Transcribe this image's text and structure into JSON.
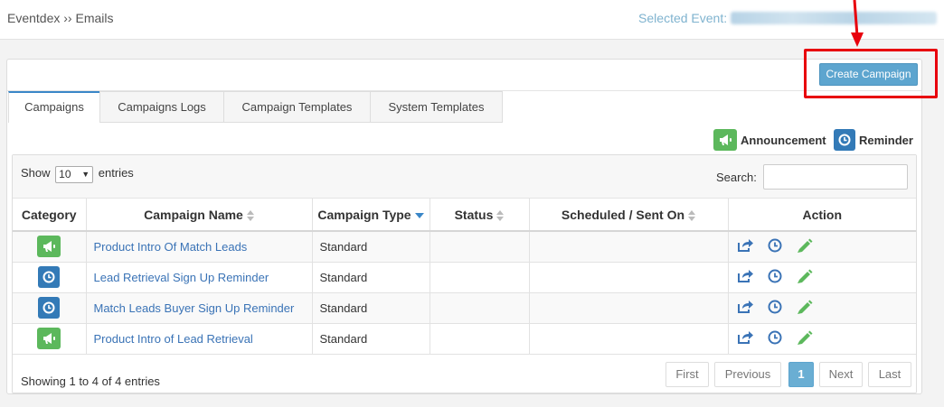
{
  "breadcrumb": "Eventdex ›› Emails",
  "selected_event_label": "Selected Event:",
  "create_button": "Create Campaign",
  "tabs": [
    {
      "label": "Campaigns",
      "active": true
    },
    {
      "label": "Campaigns Logs",
      "active": false
    },
    {
      "label": "Campaign Templates",
      "active": false
    },
    {
      "label": "System Templates",
      "active": false
    }
  ],
  "legend": {
    "announcement": "Announcement",
    "reminder": "Reminder"
  },
  "controls": {
    "show": "Show",
    "page_size": "10",
    "entries": "entries",
    "search": "Search:"
  },
  "table": {
    "headers": [
      "Category",
      "Campaign Name",
      "Campaign Type",
      "Status",
      "Scheduled / Sent On",
      "Action"
    ],
    "rows": [
      {
        "category": "announcement",
        "name": "Product Intro Of Match Leads",
        "type": "Standard",
        "status": "",
        "scheduled": ""
      },
      {
        "category": "reminder",
        "name": "Lead Retrieval Sign Up Reminder",
        "type": "Standard",
        "status": "",
        "scheduled": ""
      },
      {
        "category": "reminder",
        "name": "Match Leads Buyer Sign Up Reminder",
        "type": "Standard",
        "status": "",
        "scheduled": ""
      },
      {
        "category": "announcement",
        "name": "Product Intro of Lead Retrieval",
        "type": "Standard",
        "status": "",
        "scheduled": ""
      }
    ]
  },
  "footer": {
    "info": "Showing 1 to 4 of 4 entries"
  },
  "pagination": {
    "first": "First",
    "previous": "Previous",
    "page": "1",
    "next": "Next",
    "last": "Last"
  },
  "colors": {
    "announcement": "#5cb85c",
    "reminder": "#337ab7",
    "link": "#3a73b6",
    "accent": "#5da5cf",
    "highlight": "#e8000d"
  }
}
